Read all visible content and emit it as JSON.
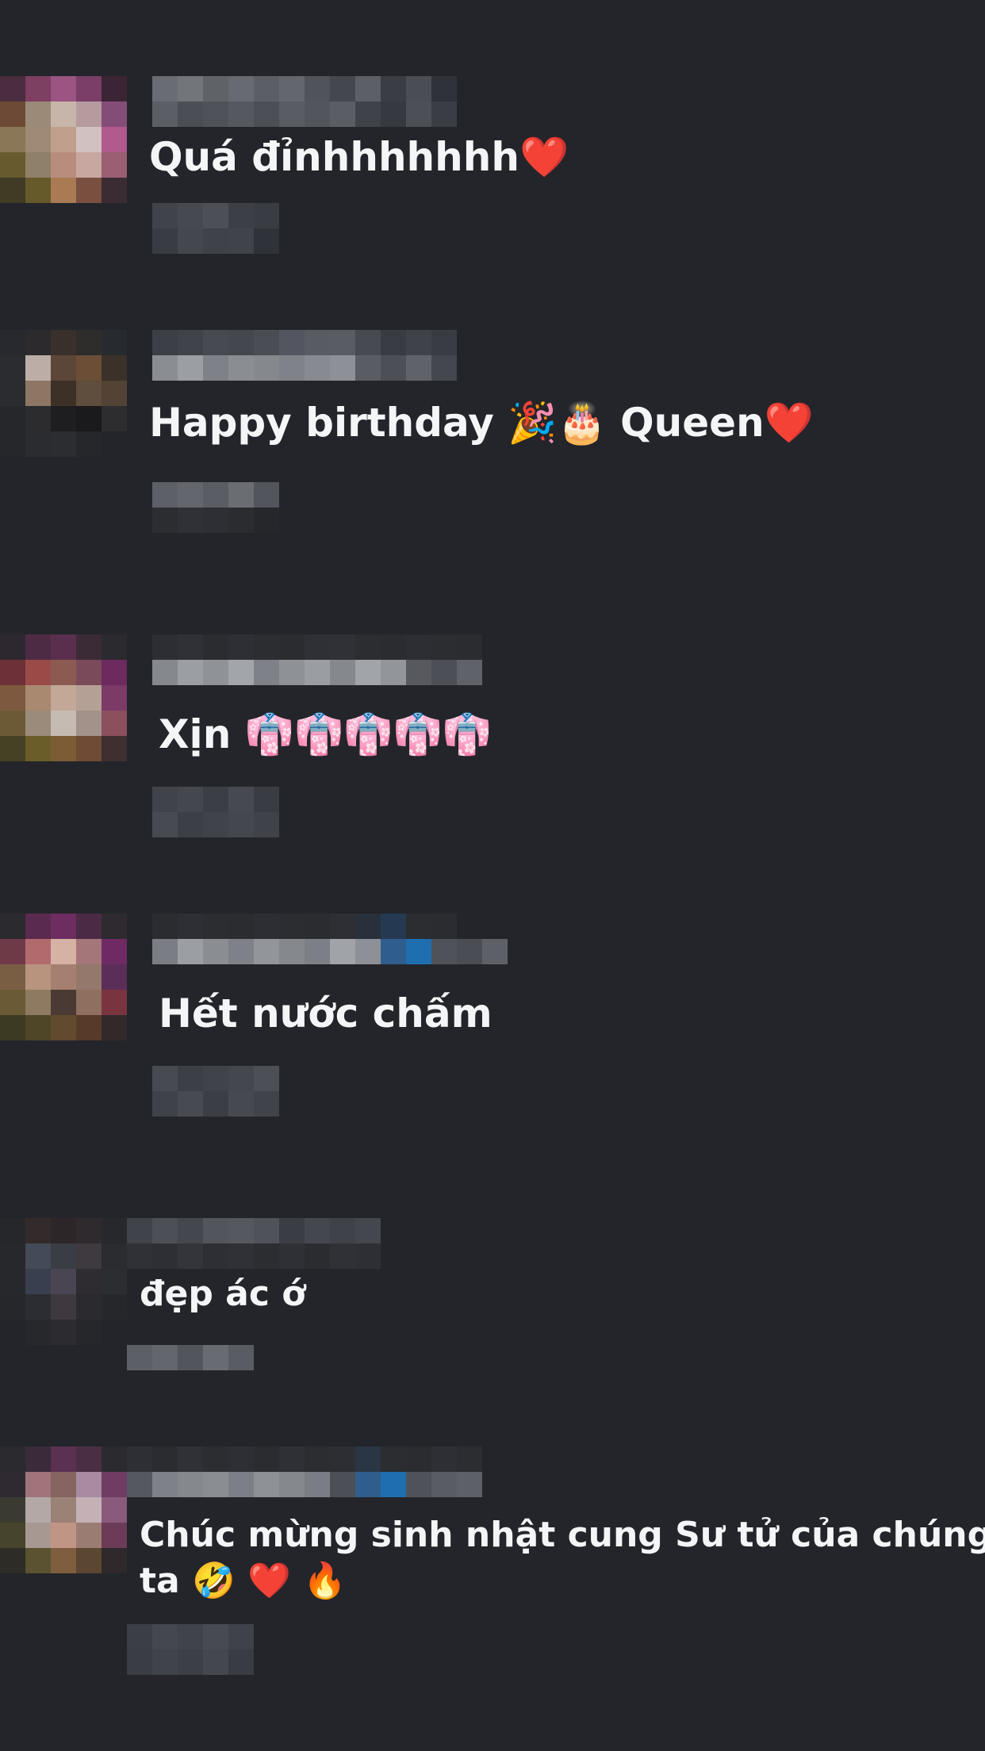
{
  "comments": [
    {
      "text": "Quá đỉnhhhhhhh❤️"
    },
    {
      "text": "Happy birthday 🎉🎂 Queen❤️"
    },
    {
      "text": "Xịn 👘👘👘👘👘"
    },
    {
      "text": "Hết nước chấm"
    },
    {
      "text": "đẹp ác ớ"
    },
    {
      "text": "Chúc mừng sinh nhật cung Sư tử của chúng ta 🤣 ❤️ 🔥"
    }
  ],
  "colors": {
    "background": "#23252a",
    "text": "#f4f5f7"
  }
}
